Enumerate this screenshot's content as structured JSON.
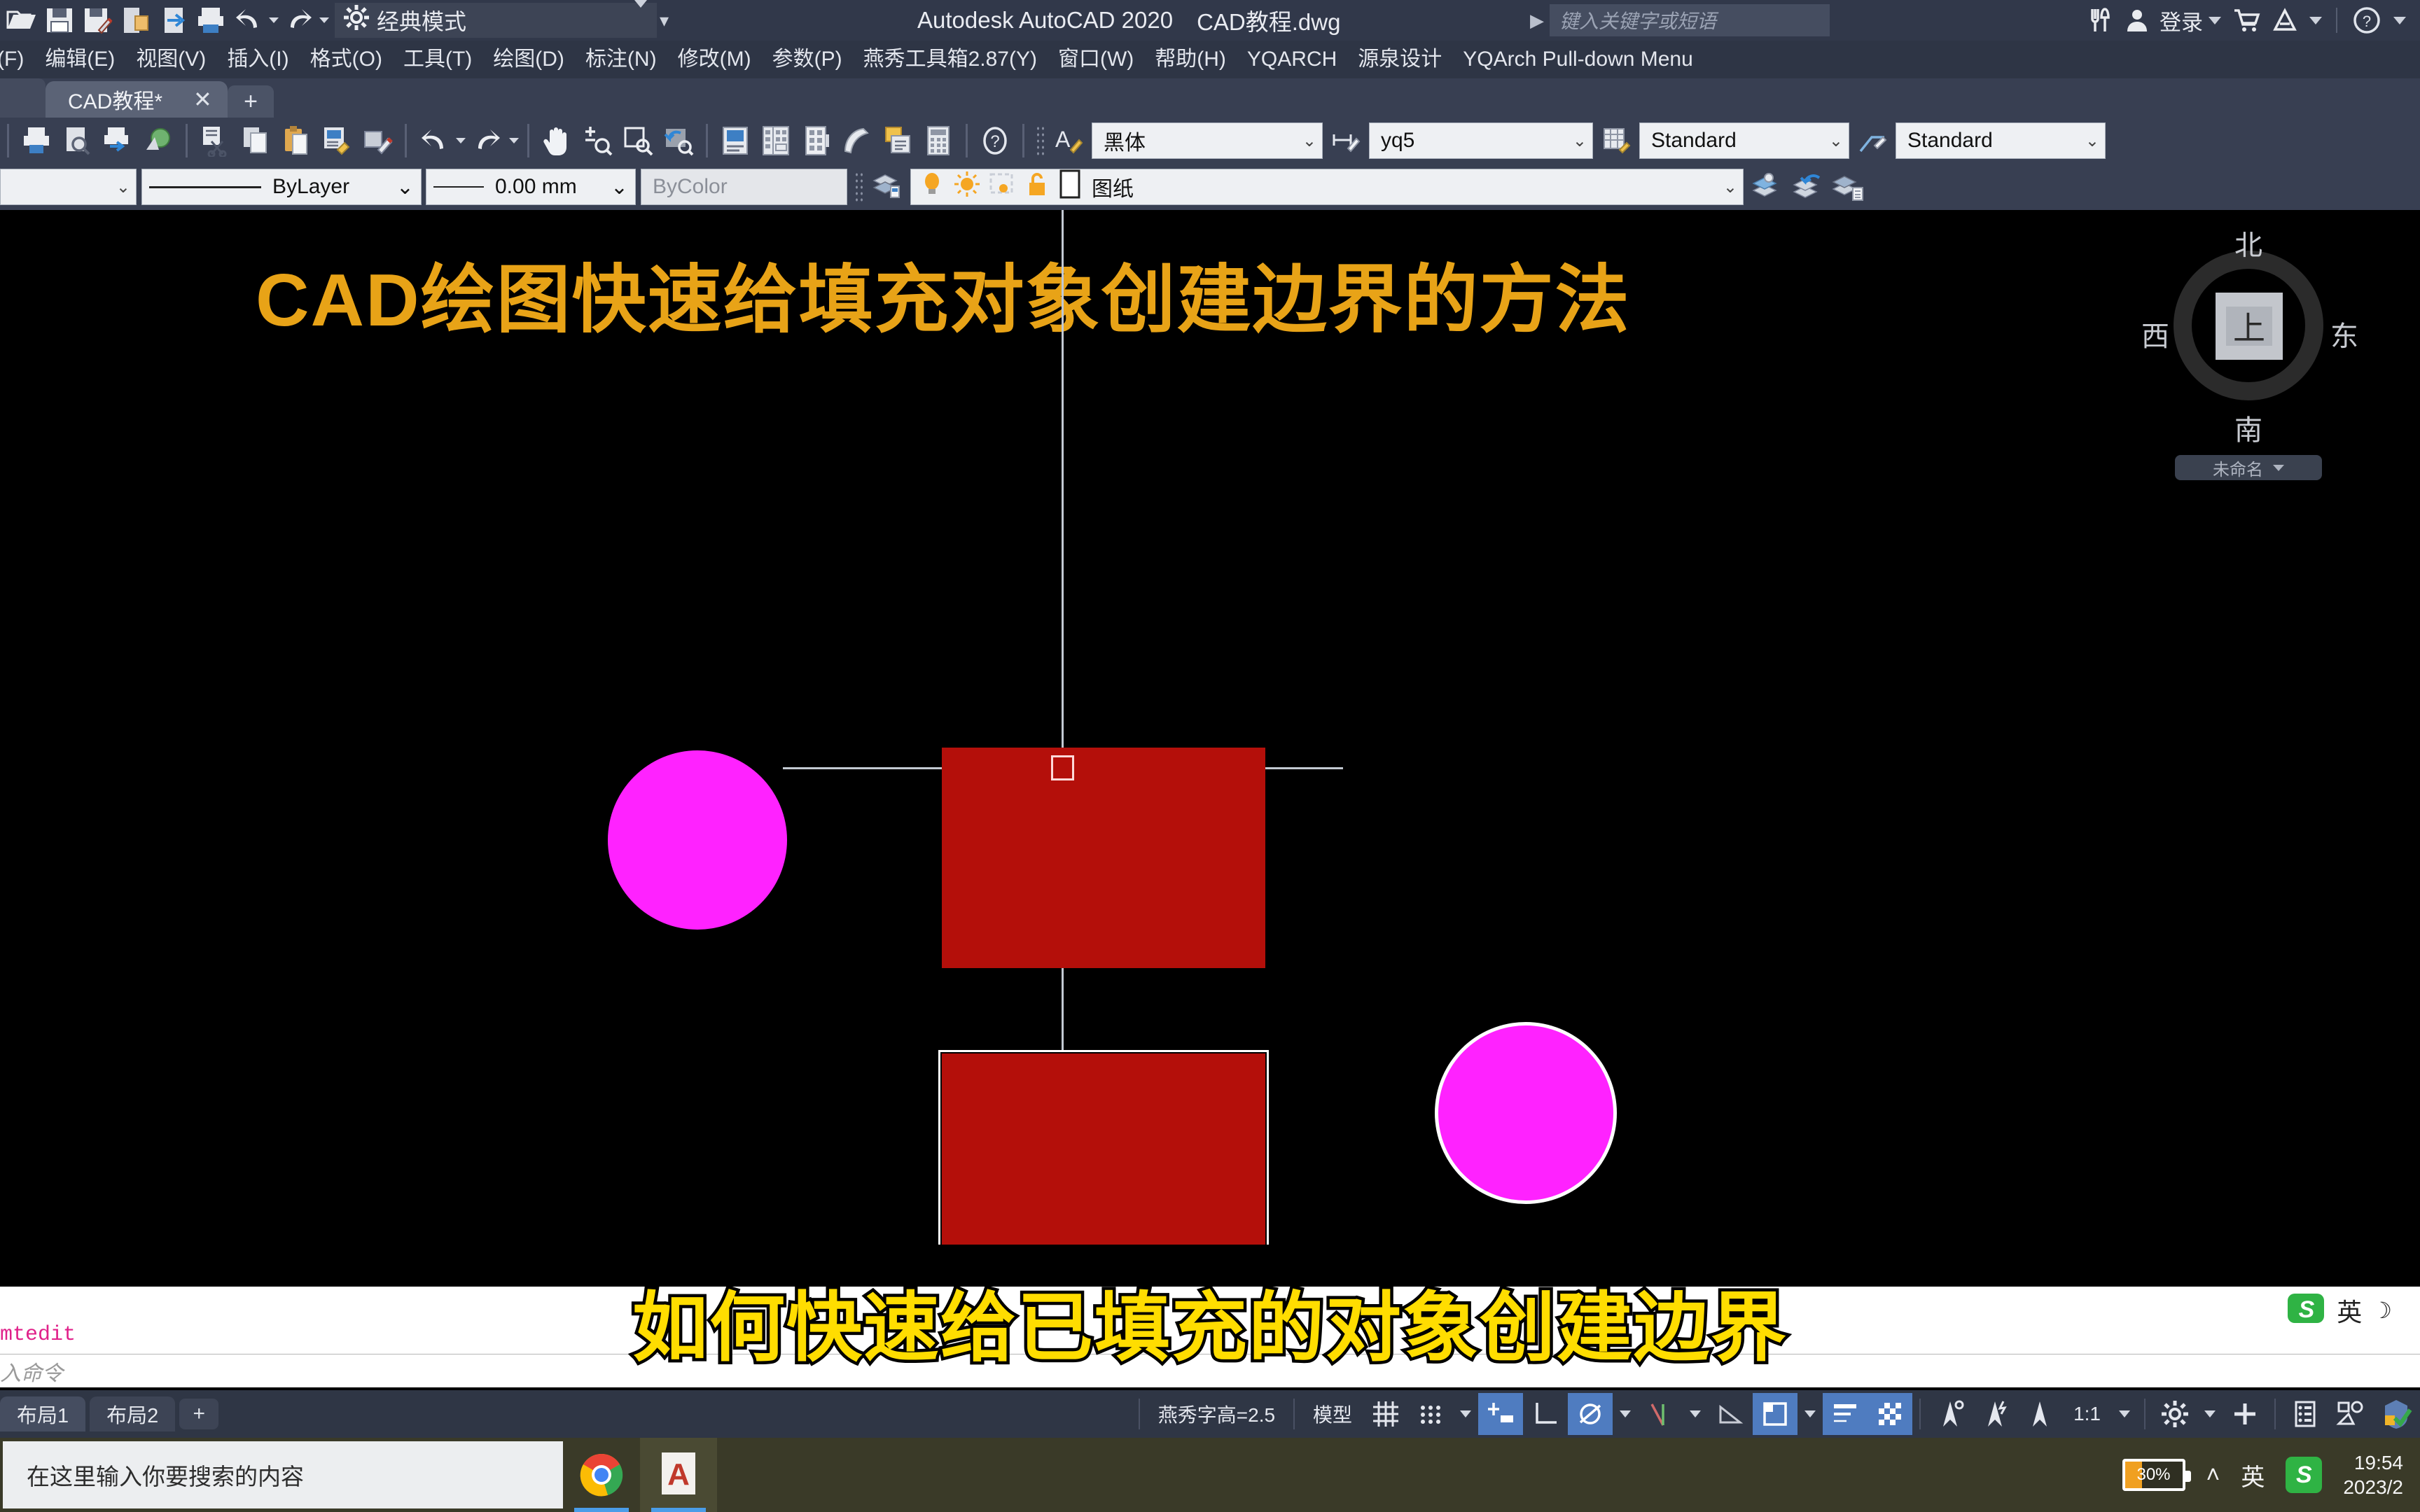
{
  "titlebar": {
    "workspace": "经典模式",
    "app_title": "Autodesk AutoCAD 2020",
    "doc_title": "CAD教程.dwg",
    "search_placeholder": "键入关键字或短语",
    "signin": "登录",
    "quick_access_icons": [
      "open-icon",
      "save-icon",
      "save-as-icon",
      "export-icon",
      "publish-icon",
      "plot-icon",
      "undo-icon",
      "redo-icon"
    ]
  },
  "menubar": {
    "items": [
      "(F)",
      "编辑(E)",
      "视图(V)",
      "插入(I)",
      "格式(O)",
      "工具(T)",
      "绘图(D)",
      "标注(N)",
      "修改(M)",
      "参数(P)",
      "燕秀工具箱2.87(Y)",
      "窗口(W)",
      "帮助(H)",
      "YQARCH",
      "源泉设计",
      "YQArch Pull-down Menu"
    ]
  },
  "doctabs": {
    "active_tab": "CAD教程*",
    "close_label": "✕",
    "new_tab_label": "+"
  },
  "toolbar1": {
    "text_style": "黑体",
    "dim_style": "yq5",
    "table_style": "Standard",
    "mleader_style": "Standard"
  },
  "toolbar2": {
    "color_value": "",
    "linetype": "ByLayer",
    "lineweight": "0.00 mm",
    "plotstyle": "ByColor",
    "layer": "图纸"
  },
  "canvas": {
    "title": "CAD绘图快速给填充对象创建边界的方法",
    "title_color": "#e8a317",
    "background": "#000000",
    "hatch_color": "#b40f0a",
    "circle_color": "#ff22ff",
    "viewcube": {
      "north": "北",
      "south": "南",
      "west": "西",
      "east": "东",
      "top": "上",
      "view_name": "未命名"
    }
  },
  "subtitle": {
    "text": "如何快速给已填充的对象创建边界",
    "color": "#ffdd00"
  },
  "command": {
    "history": "mtedit",
    "prompt_placeholder": "入命令"
  },
  "statusbar": {
    "layout_tabs": [
      "布局1",
      "布局2"
    ],
    "add_layout": "+",
    "text_height": "燕秀字高=2.5",
    "space_mode": "模型",
    "scale": "1:1"
  },
  "taskbar": {
    "search_placeholder": "在这里输入你要搜索的内容",
    "apps": [
      "chrome-icon",
      "autocad-icon"
    ],
    "battery_percent": "30%",
    "battery_value": 30,
    "ime": "英",
    "sogou": "S",
    "time": "19:54",
    "date": "2023/2"
  }
}
